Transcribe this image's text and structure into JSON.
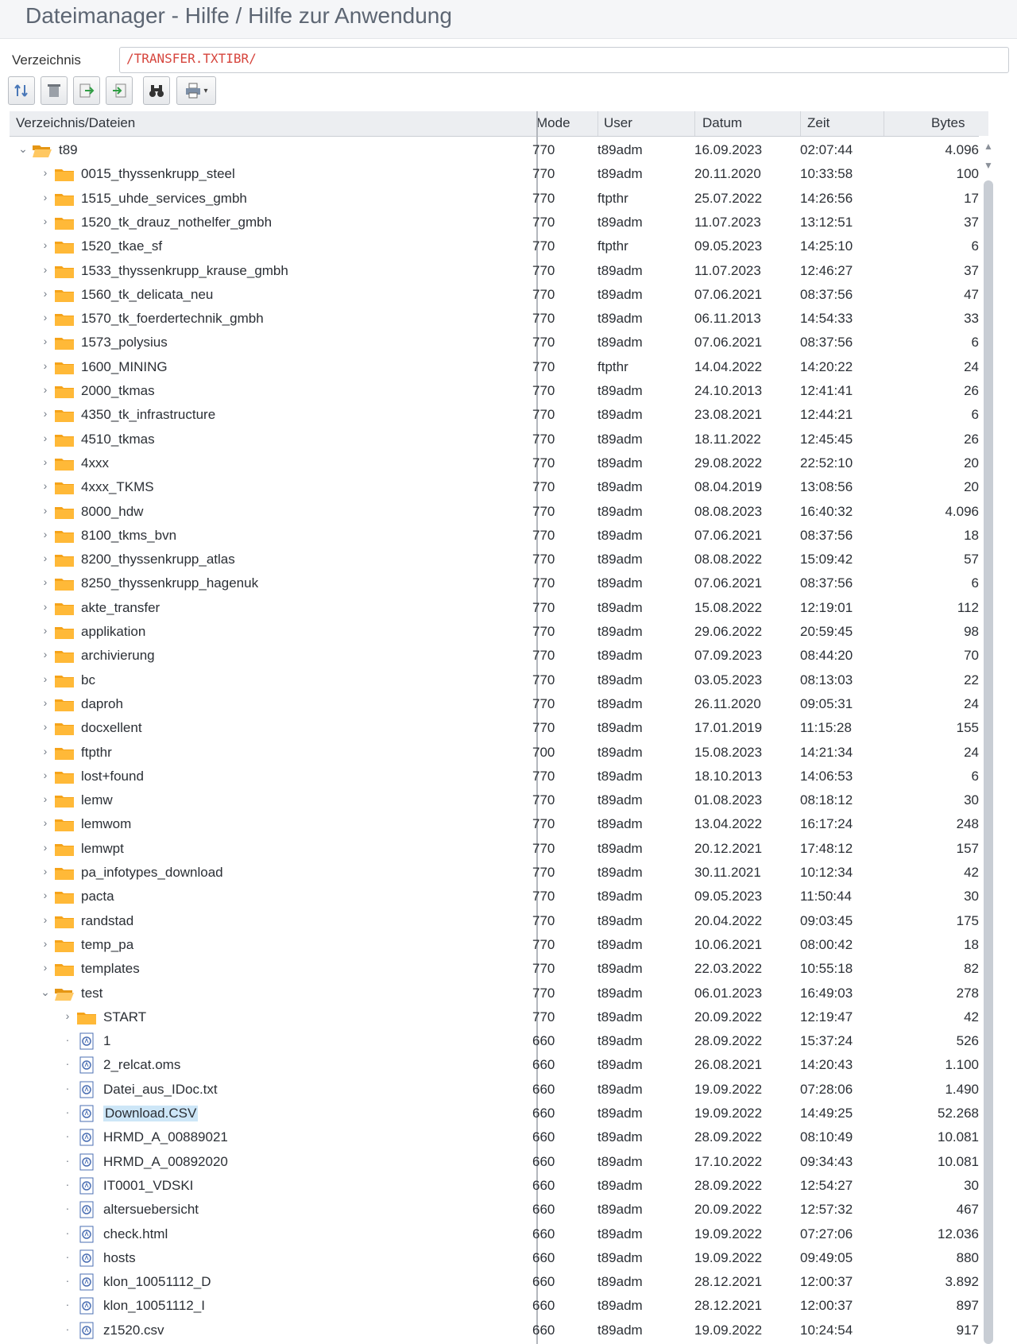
{
  "window": {
    "title": "Dateimanager - Hilfe / Hilfe zur Anwendung"
  },
  "directory": {
    "label": "Verzeichnis",
    "value": "/TRANSFER.TXTIBR/"
  },
  "toolbar": {
    "icons": [
      "refresh-icon",
      "delete-icon",
      "upload-icon",
      "download-icon",
      "binoculars-icon",
      "print-icon"
    ]
  },
  "columns": {
    "name": "Verzeichnis/Dateien",
    "mode": "Mode",
    "user": "User",
    "date": "Datum",
    "time": "Zeit",
    "bytes": "Bytes"
  },
  "rows": [
    {
      "name": "t89",
      "type": "folder-open",
      "mode": "770",
      "user": "t89adm",
      "date": "16.09.2023",
      "time": "02:07:44",
      "bytes": "4.096"
    },
    {
      "name": "0015_thyssenkrupp_steel",
      "type": "folder",
      "mode": "770",
      "user": "t89adm",
      "date": "20.11.2020",
      "time": "10:33:58",
      "bytes": "100"
    },
    {
      "name": "1515_uhde_services_gmbh",
      "type": "folder",
      "mode": "770",
      "user": "ftpthr",
      "date": "25.07.2022",
      "time": "14:26:56",
      "bytes": "17"
    },
    {
      "name": "1520_tk_drauz_nothelfer_gmbh",
      "type": "folder",
      "mode": "770",
      "user": "t89adm",
      "date": "11.07.2023",
      "time": "13:12:51",
      "bytes": "37"
    },
    {
      "name": "1520_tkae_sf",
      "type": "folder",
      "mode": "770",
      "user": "ftpthr",
      "date": "09.05.2023",
      "time": "14:25:10",
      "bytes": "6"
    },
    {
      "name": "1533_thyssenkrupp_krause_gmbh",
      "type": "folder",
      "mode": "770",
      "user": "t89adm",
      "date": "11.07.2023",
      "time": "12:46:27",
      "bytes": "37"
    },
    {
      "name": "1560_tk_delicata_neu",
      "type": "folder",
      "mode": "770",
      "user": "t89adm",
      "date": "07.06.2021",
      "time": "08:37:56",
      "bytes": "47"
    },
    {
      "name": "1570_tk_foerdertechnik_gmbh",
      "type": "folder",
      "mode": "770",
      "user": "t89adm",
      "date": "06.11.2013",
      "time": "14:54:33",
      "bytes": "33"
    },
    {
      "name": "1573_polysius",
      "type": "folder",
      "mode": "770",
      "user": "t89adm",
      "date": "07.06.2021",
      "time": "08:37:56",
      "bytes": "6"
    },
    {
      "name": "1600_MINING",
      "type": "folder",
      "mode": "770",
      "user": "ftpthr",
      "date": "14.04.2022",
      "time": "14:20:22",
      "bytes": "24"
    },
    {
      "name": "2000_tkmas",
      "type": "folder",
      "mode": "770",
      "user": "t89adm",
      "date": "24.10.2013",
      "time": "12:41:41",
      "bytes": "26"
    },
    {
      "name": "4350_tk_infrastructure",
      "type": "folder",
      "mode": "770",
      "user": "t89adm",
      "date": "23.08.2021",
      "time": "12:44:21",
      "bytes": "6"
    },
    {
      "name": "4510_tkmas",
      "type": "folder",
      "mode": "770",
      "user": "t89adm",
      "date": "18.11.2022",
      "time": "12:45:45",
      "bytes": "26"
    },
    {
      "name": "4xxx",
      "type": "folder",
      "mode": "770",
      "user": "t89adm",
      "date": "29.08.2022",
      "time": "22:52:10",
      "bytes": "20"
    },
    {
      "name": "4xxx_TKMS",
      "type": "folder",
      "mode": "770",
      "user": "t89adm",
      "date": "08.04.2019",
      "time": "13:08:56",
      "bytes": "20"
    },
    {
      "name": "8000_hdw",
      "type": "folder",
      "mode": "770",
      "user": "t89adm",
      "date": "08.08.2023",
      "time": "16:40:32",
      "bytes": "4.096"
    },
    {
      "name": "8100_tkms_bvn",
      "type": "folder",
      "mode": "770",
      "user": "t89adm",
      "date": "07.06.2021",
      "time": "08:37:56",
      "bytes": "18"
    },
    {
      "name": "8200_thyssenkrupp_atlas",
      "type": "folder",
      "mode": "770",
      "user": "t89adm",
      "date": "08.08.2022",
      "time": "15:09:42",
      "bytes": "57"
    },
    {
      "name": "8250_thyssenkrupp_hagenuk",
      "type": "folder",
      "mode": "770",
      "user": "t89adm",
      "date": "07.06.2021",
      "time": "08:37:56",
      "bytes": "6"
    },
    {
      "name": "akte_transfer",
      "type": "folder",
      "mode": "770",
      "user": "t89adm",
      "date": "15.08.2022",
      "time": "12:19:01",
      "bytes": "112"
    },
    {
      "name": "applikation",
      "type": "folder",
      "mode": "770",
      "user": "t89adm",
      "date": "29.06.2022",
      "time": "20:59:45",
      "bytes": "98"
    },
    {
      "name": "archivierung",
      "type": "folder",
      "mode": "770",
      "user": "t89adm",
      "date": "07.09.2023",
      "time": "08:44:20",
      "bytes": "70"
    },
    {
      "name": "bc",
      "type": "folder",
      "mode": "770",
      "user": "t89adm",
      "date": "03.05.2023",
      "time": "08:13:03",
      "bytes": "22"
    },
    {
      "name": "daproh",
      "type": "folder",
      "mode": "770",
      "user": "t89adm",
      "date": "26.11.2020",
      "time": "09:05:31",
      "bytes": "24"
    },
    {
      "name": "docxellent",
      "type": "folder",
      "mode": "770",
      "user": "t89adm",
      "date": "17.01.2019",
      "time": "11:15:28",
      "bytes": "155"
    },
    {
      "name": "ftpthr",
      "type": "folder",
      "mode": "700",
      "user": "t89adm",
      "date": "15.08.2023",
      "time": "14:21:34",
      "bytes": "24"
    },
    {
      "name": "lost+found",
      "type": "folder",
      "mode": "770",
      "user": "t89adm",
      "date": "18.10.2013",
      "time": "14:06:53",
      "bytes": "6"
    },
    {
      "name": "lemw",
      "type": "folder",
      "mode": "770",
      "user": "t89adm",
      "date": "01.08.2023",
      "time": "08:18:12",
      "bytes": "30"
    },
    {
      "name": "lemwom",
      "type": "folder",
      "mode": "770",
      "user": "t89adm",
      "date": "13.04.2022",
      "time": "16:17:24",
      "bytes": "248"
    },
    {
      "name": "lemwpt",
      "type": "folder",
      "mode": "770",
      "user": "t89adm",
      "date": "20.12.2021",
      "time": "17:48:12",
      "bytes": "157"
    },
    {
      "name": "pa_infotypes_download",
      "type": "folder",
      "mode": "770",
      "user": "t89adm",
      "date": "30.11.2021",
      "time": "10:12:34",
      "bytes": "42"
    },
    {
      "name": "pacta",
      "type": "folder",
      "mode": "770",
      "user": "t89adm",
      "date": "09.05.2023",
      "time": "11:50:44",
      "bytes": "30"
    },
    {
      "name": "randstad",
      "type": "folder",
      "mode": "770",
      "user": "t89adm",
      "date": "20.04.2022",
      "time": "09:03:45",
      "bytes": "175"
    },
    {
      "name": "temp_pa",
      "type": "folder",
      "mode": "770",
      "user": "t89adm",
      "date": "10.06.2021",
      "time": "08:00:42",
      "bytes": "18"
    },
    {
      "name": "templates",
      "type": "folder",
      "mode": "770",
      "user": "t89adm",
      "date": "22.03.2022",
      "time": "10:55:18",
      "bytes": "82"
    },
    {
      "name": "test",
      "type": "folder-open",
      "mode": "770",
      "user": "t89adm",
      "date": "06.01.2023",
      "time": "16:49:03",
      "bytes": "278"
    },
    {
      "name": "START",
      "type": "folder",
      "mode": "770",
      "user": "t89adm",
      "date": "20.09.2022",
      "time": "12:19:47",
      "bytes": "42"
    },
    {
      "name": "1",
      "type": "file",
      "mode": "660",
      "user": "t89adm",
      "date": "28.09.2022",
      "time": "15:37:24",
      "bytes": "526"
    },
    {
      "name": "2_relcat.oms",
      "type": "file",
      "mode": "660",
      "user": "t89adm",
      "date": "26.08.2021",
      "time": "14:20:43",
      "bytes": "1.100"
    },
    {
      "name": "Datei_aus_IDoc.txt",
      "type": "file",
      "mode": "660",
      "user": "t89adm",
      "date": "19.09.2022",
      "time": "07:28:06",
      "bytes": "1.490"
    },
    {
      "name": "Download.CSV",
      "type": "file",
      "selected": true,
      "mode": "660",
      "user": "t89adm",
      "date": "19.09.2022",
      "time": "14:49:25",
      "bytes": "52.268"
    },
    {
      "name": "HRMD_A_00889021",
      "type": "file",
      "mode": "660",
      "user": "t89adm",
      "date": "28.09.2022",
      "time": "08:10:49",
      "bytes": "10.081"
    },
    {
      "name": "HRMD_A_00892020",
      "type": "file",
      "mode": "660",
      "user": "t89adm",
      "date": "17.10.2022",
      "time": "09:34:43",
      "bytes": "10.081"
    },
    {
      "name": "IT0001_VDSKI",
      "type": "file",
      "mode": "660",
      "user": "t89adm",
      "date": "28.09.2022",
      "time": "12:54:27",
      "bytes": "30"
    },
    {
      "name": "altersuebersicht",
      "type": "file",
      "mode": "660",
      "user": "t89adm",
      "date": "20.09.2022",
      "time": "12:57:32",
      "bytes": "467"
    },
    {
      "name": "check.html",
      "type": "file",
      "mode": "660",
      "user": "t89adm",
      "date": "19.09.2022",
      "time": "07:27:06",
      "bytes": "12.036"
    },
    {
      "name": "hosts",
      "type": "file",
      "mode": "660",
      "user": "t89adm",
      "date": "19.09.2022",
      "time": "09:49:05",
      "bytes": "880"
    },
    {
      "name": "klon_10051112_D",
      "type": "file",
      "mode": "660",
      "user": "t89adm",
      "date": "28.12.2021",
      "time": "12:00:37",
      "bytes": "3.892"
    },
    {
      "name": "klon_10051112_I",
      "type": "file",
      "mode": "660",
      "user": "t89adm",
      "date": "28.12.2021",
      "time": "12:00:37",
      "bytes": "897"
    },
    {
      "name": "z1520.csv",
      "type": "file",
      "mode": "660",
      "user": "t89adm",
      "date": "19.09.2022",
      "time": "10:24:54",
      "bytes": "917"
    }
  ]
}
